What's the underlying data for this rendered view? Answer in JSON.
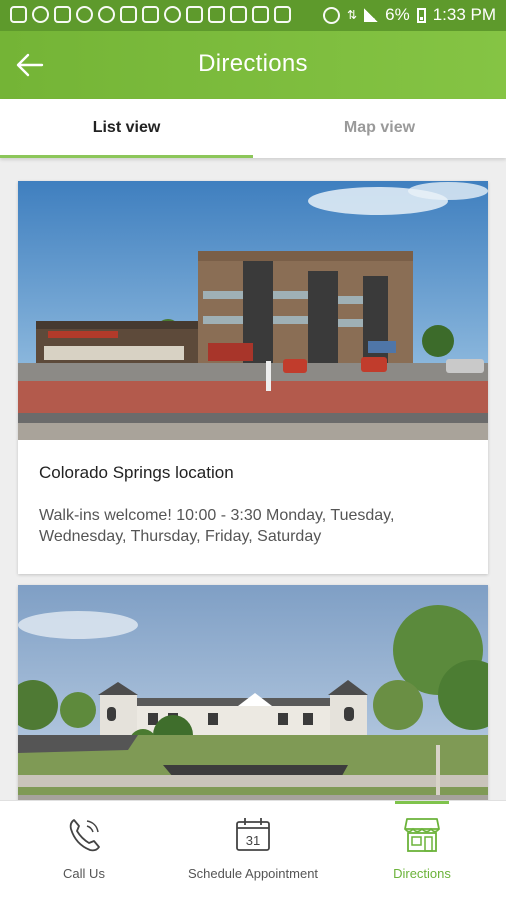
{
  "status_bar": {
    "battery": "6%",
    "time": "1:33 PM"
  },
  "app_bar": {
    "title": "Directions",
    "back_icon": "arrow-left-icon"
  },
  "tabs": [
    {
      "label": "List view",
      "selected": true
    },
    {
      "label": "Map view",
      "selected": false
    }
  ],
  "locations": [
    {
      "title": "Colorado Springs location",
      "description": "Walk-ins welcome! 10:00 - 3:30 Monday, Tuesday, Wednesday, Thursday, Friday, Saturday"
    },
    {
      "title": "",
      "description": ""
    }
  ],
  "bottom_nav": [
    {
      "label": "Call Us",
      "icon": "phone-icon",
      "active": false
    },
    {
      "label": "Schedule Appointment",
      "icon": "calendar-icon",
      "calendar_day": "31",
      "active": false
    },
    {
      "label": "Directions",
      "icon": "storefront-icon",
      "active": true
    }
  ],
  "colors": {
    "accent": "#7ab83c",
    "active_tab": "#8cc65a",
    "nav_active": "#6bb33a"
  }
}
